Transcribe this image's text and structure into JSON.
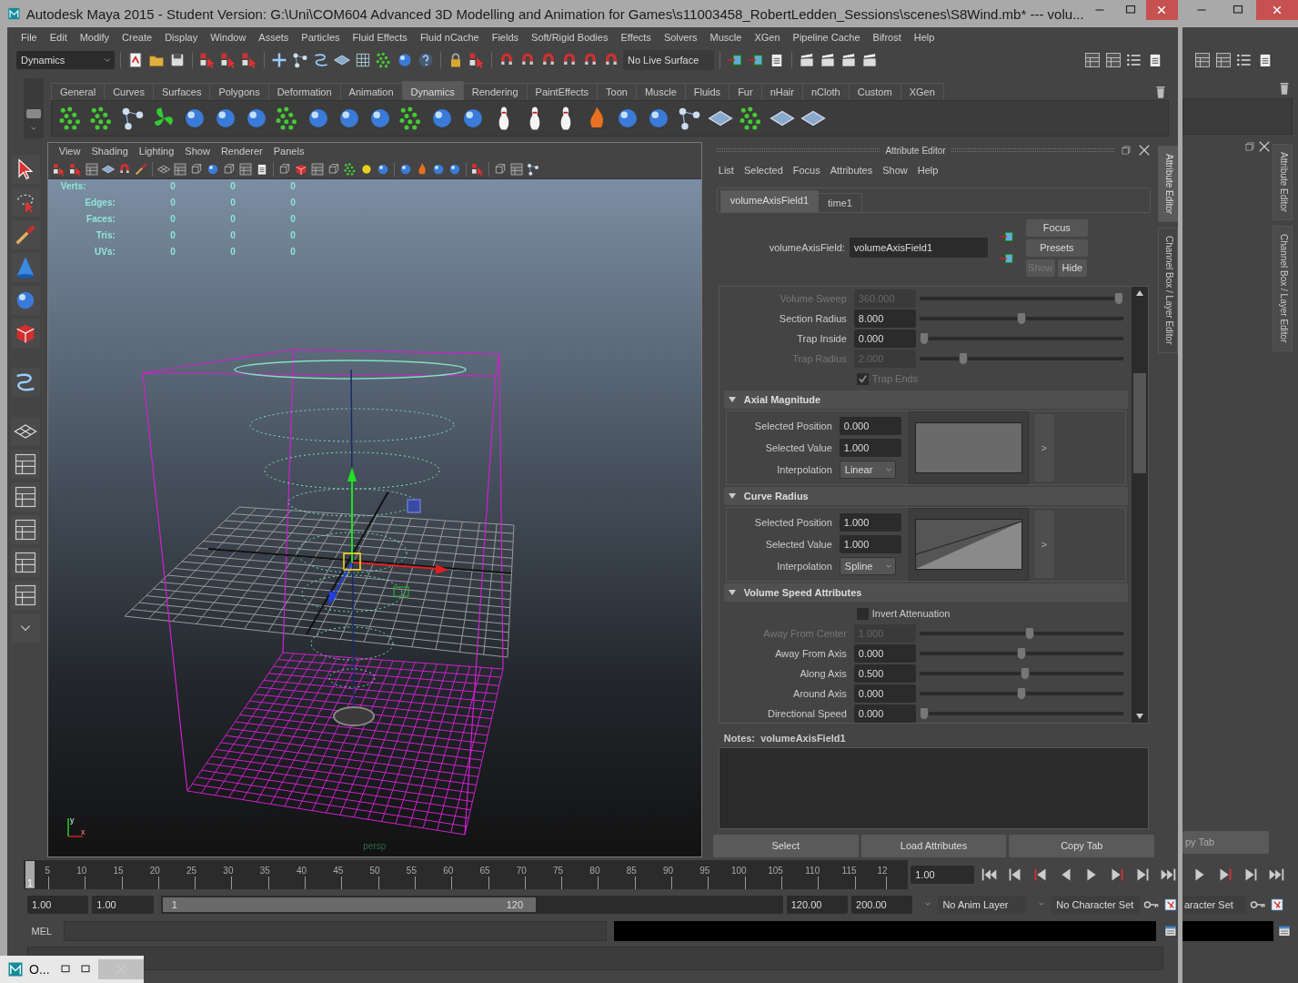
{
  "window": {
    "title": "Autodesk Maya 2015 - Student Version: G:\\Uni\\COM604 Advanced 3D Modelling and Animation for Games\\s11003458_RobertLedden_Sessions\\scenes\\S8Wind.mb*   ---   volu..."
  },
  "menu_bar": [
    "File",
    "Edit",
    "Modify",
    "Create",
    "Display",
    "Window",
    "Assets",
    "Particles",
    "Fluid Effects",
    "Fluid nCache",
    "Fields",
    "Soft/Rigid Bodies",
    "Effects",
    "Solvers",
    "Muscle",
    "XGen",
    "Pipeline Cache",
    "Bifrost",
    "Help"
  ],
  "status_line": {
    "menu_set": "Dynamics",
    "live_surface": "No Live Surface"
  },
  "shelf": {
    "tabs": [
      {
        "label": "General",
        "selected": false
      },
      {
        "label": "Curves",
        "selected": false
      },
      {
        "label": "Surfaces",
        "selected": false
      },
      {
        "label": "Polygons",
        "selected": false
      },
      {
        "label": "Deformation",
        "selected": false
      },
      {
        "label": "Animation",
        "selected": false
      },
      {
        "label": "Dynamics",
        "selected": true
      },
      {
        "label": "Rendering",
        "selected": false
      },
      {
        "label": "PaintEffects",
        "selected": false
      },
      {
        "label": "Toon",
        "selected": false
      },
      {
        "label": "Muscle",
        "selected": false
      },
      {
        "label": "Fluids",
        "selected": false
      },
      {
        "label": "Fur",
        "selected": false
      },
      {
        "label": "nHair",
        "selected": false
      },
      {
        "label": "nCloth",
        "selected": false
      },
      {
        "label": "Custom",
        "selected": false
      },
      {
        "label": "XGen",
        "selected": false
      }
    ]
  },
  "viewport": {
    "menu": [
      "View",
      "Shading",
      "Lighting",
      "Show",
      "Renderer",
      "Panels"
    ],
    "hud": [
      {
        "label": "Verts:",
        "values": [
          "0",
          "0",
          "0"
        ]
      },
      {
        "label": "Edges:",
        "values": [
          "0",
          "0",
          "0"
        ]
      },
      {
        "label": "Faces:",
        "values": [
          "0",
          "0",
          "0"
        ]
      },
      {
        "label": "Tris:",
        "values": [
          "0",
          "0",
          "0"
        ]
      },
      {
        "label": "UVs:",
        "values": [
          "0",
          "0",
          "0"
        ]
      }
    ],
    "axis_labels": [
      "y",
      "x"
    ],
    "camera": "persp"
  },
  "attribute_editor": {
    "title": "Attribute Editor",
    "menu": [
      "List",
      "Selected",
      "Focus",
      "Attributes",
      "Show",
      "Help"
    ],
    "tabs": [
      {
        "label": "volumeAxisField1",
        "selected": true
      },
      {
        "label": "time1",
        "selected": false
      }
    ],
    "node_label": "volumeAxisField:",
    "node_name": "volumeAxisField1",
    "buttons": [
      "Focus",
      "Presets"
    ],
    "show_button": "Show",
    "hide_button": "Hide",
    "rows": [
      {
        "kind": "slider",
        "label": "Volume Sweep",
        "value": "360.000",
        "disabled": true,
        "level": 1
      },
      {
        "kind": "slider",
        "label": "Section Radius",
        "value": "8.000",
        "disabled": false,
        "level": 0.5
      },
      {
        "kind": "slider",
        "label": "Trap Inside",
        "value": "0.000",
        "disabled": false,
        "level": 0
      },
      {
        "kind": "slider",
        "label": "Trap Radius",
        "value": "2.000",
        "disabled": true,
        "level": 0.2
      },
      {
        "kind": "checkbox",
        "label": "Trap Ends",
        "checked": true,
        "disabled": true
      },
      {
        "kind": "section",
        "label": "Axial Magnitude",
        "expanded": true
      },
      {
        "kind": "ramp",
        "fields": [
          {
            "label": "Selected Position",
            "value": "0.000"
          },
          {
            "label": "Selected Value",
            "value": "1.000"
          }
        ],
        "interpolation": {
          "label": "Interpolation",
          "value": "Linear"
        },
        "graph": {
          "kind": "flat"
        },
        "expand_label": ">"
      },
      {
        "kind": "section",
        "label": "Curve Radius",
        "expanded": true
      },
      {
        "kind": "ramp",
        "fields": [
          {
            "label": "Selected Position",
            "value": "1.000"
          },
          {
            "label": "Selected Value",
            "value": "1.000"
          }
        ],
        "interpolation": {
          "label": "Interpolation",
          "value": "Spline"
        },
        "graph": {
          "kind": "rising"
        },
        "expand_label": ">"
      },
      {
        "kind": "section",
        "label": "Volume Speed Attributes",
        "expanded": true
      },
      {
        "kind": "checkbox",
        "label": "Invert Attenuation",
        "checked": false,
        "disabled": false
      },
      {
        "kind": "slider",
        "label": "Away From Center",
        "value": "1.000",
        "disabled": true,
        "level": 0.54
      },
      {
        "kind": "slider",
        "label": "Away From Axis",
        "value": "0.000",
        "disabled": false,
        "level": 0.5
      },
      {
        "kind": "slider",
        "label": "Along Axis",
        "value": "0.500",
        "disabled": false,
        "level": 0.52
      },
      {
        "kind": "slider",
        "label": "Around Axis",
        "value": "0.000",
        "disabled": false,
        "level": 0.5
      },
      {
        "kind": "slider",
        "label": "Directional Speed",
        "value": "0.000",
        "disabled": false,
        "level": 0
      }
    ],
    "notes_label": "Notes:  volumeAxisField1",
    "bottom_buttons": [
      "Select",
      "Load Attributes",
      "Copy Tab"
    ]
  },
  "side_tabs": [
    {
      "label": "Attribute Editor",
      "selected": true
    },
    {
      "label": "Channel Box / Layer Editor",
      "selected": false
    }
  ],
  "timeline": {
    "ticks": [
      "5",
      "10",
      "15",
      "20",
      "25",
      "30",
      "35",
      "40",
      "45",
      "50",
      "55",
      "60",
      "65",
      "70",
      "75",
      "80",
      "85",
      "90",
      "95",
      "100",
      "105",
      "110",
      "115",
      "12"
    ],
    "current_frame": "1",
    "level": 0,
    "current_time": "1.00"
  },
  "range_slider": {
    "start_time": "1.00",
    "playback_start": "1.00",
    "range_start": "1",
    "range_end": "120",
    "level": 0.6,
    "playback_end": "120.00",
    "end_time": "200.00",
    "anim_layer": "No Anim Layer",
    "character_set": "No Character Set"
  },
  "command_line": {
    "language": "MEL"
  },
  "taskbar_preview": {
    "title": "O..."
  },
  "background_window": {
    "side_tabs": [
      "Attribute Editor",
      "Channel Box / Layer Editor"
    ],
    "button": "py Tab",
    "character_set": "aracter Set"
  }
}
